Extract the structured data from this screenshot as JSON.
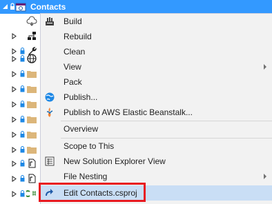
{
  "tree": {
    "project_name": "Contacts"
  },
  "menu": {
    "items": [
      {
        "label": "Build",
        "icon": "build-icon"
      },
      {
        "label": "Rebuild",
        "icon": ""
      },
      {
        "label": "Clean",
        "icon": ""
      },
      {
        "label": "View",
        "icon": "",
        "submenu": true
      },
      {
        "label": "Pack",
        "icon": ""
      },
      {
        "label": "Publish...",
        "icon": "globe-icon"
      },
      {
        "label": "Publish to AWS Elastic Beanstalk...",
        "icon": "aws-beanstalk-icon"
      },
      {
        "label": "Overview",
        "icon": ""
      },
      {
        "label": "Scope to This",
        "icon": ""
      },
      {
        "label": "New Solution Explorer View",
        "icon": "new-view-icon"
      },
      {
        "label": "File Nesting",
        "icon": "",
        "submenu": true
      },
      {
        "label": "Edit Contacts.csproj",
        "icon": "redirect-arrow-icon",
        "highlighted": true
      }
    ]
  },
  "colors": {
    "selection": "#3399ff",
    "menu_background": "#f2f2f2",
    "highlight": "#c9def5",
    "annotation_box": "#e8191f"
  }
}
